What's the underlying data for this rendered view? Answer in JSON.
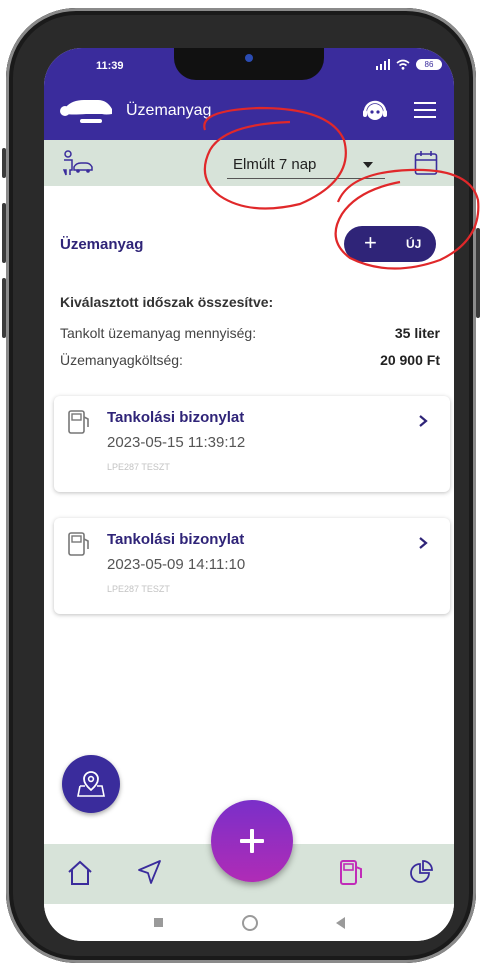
{
  "status_bar": {
    "time": "11:39",
    "battery": "86"
  },
  "app_bar": {
    "title": "Üzemanyag",
    "icons": [
      "car-icon",
      "support-headset-icon",
      "hamburger-menu-icon"
    ]
  },
  "toolbar": {
    "period_selected": "Elmúlt 7 nap",
    "icons": [
      "driver-car-icon",
      "chevron-down-icon",
      "calendar-icon"
    ]
  },
  "section": {
    "title": "Üzemanyag",
    "new_button_label": "ÚJ"
  },
  "summary": {
    "title": "Kiválasztott időszak összesítve:",
    "rows": [
      {
        "label": "Tankolt üzemanyag mennyiség:",
        "value": "35 liter"
      },
      {
        "label": "Üzemanyagköltség:",
        "value": "20 900 Ft"
      }
    ]
  },
  "receipts": [
    {
      "title": "Tankolási bizonylat",
      "datetime": "2023-05-15 11:39:12",
      "plate": "LPE287 TESZT"
    },
    {
      "title": "Tankolási bizonylat",
      "datetime": "2023-05-09 14:11:10",
      "plate": "LPE287 TESZT"
    }
  ],
  "bottom_nav": {
    "items": [
      "home-icon",
      "navigation-icon",
      "fuel-pump-icon",
      "statistics-pie-icon"
    ],
    "active": "fuel-pump-icon"
  },
  "colors": {
    "primary": "#3a2c9c",
    "dark_primary": "#2f2478",
    "toolbar_bg": "#d7e3d9",
    "fab_gradient_start": "#7a2fc9",
    "fab_gradient_end": "#b02cb6",
    "annotation": "#e0282a"
  }
}
